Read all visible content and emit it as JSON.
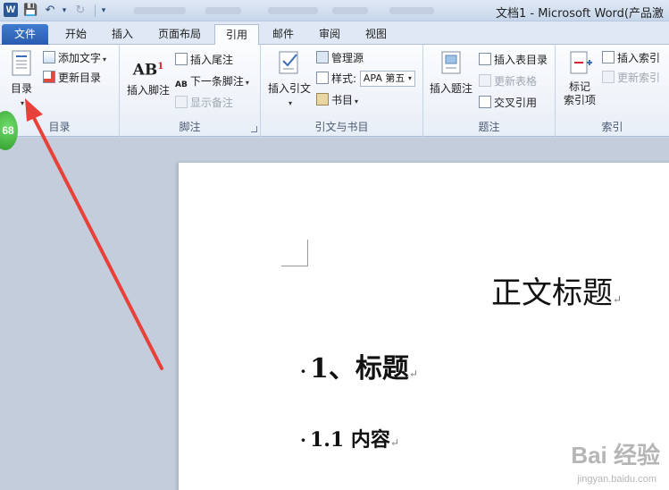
{
  "titlebar": {
    "title": "文档1 - Microsoft Word(产品激",
    "word_logo": "W"
  },
  "tabs": [
    {
      "label": "文件"
    },
    {
      "label": "开始"
    },
    {
      "label": "插入"
    },
    {
      "label": "页面布局"
    },
    {
      "label": "引用"
    },
    {
      "label": "邮件"
    },
    {
      "label": "审阅"
    },
    {
      "label": "视图"
    }
  ],
  "ribbon": {
    "toc_group": {
      "label": "目录",
      "toc_button": "目录",
      "add_text": "添加文字",
      "update_toc": "更新目录"
    },
    "footnote_group": {
      "label": "脚注",
      "insert_footnote": "插入脚注",
      "insert_endnote": "插入尾注",
      "next_footnote": "下一条脚注",
      "show_notes": "显示备注"
    },
    "citation_group": {
      "label": "引文与书目",
      "insert_citation": "插入引文",
      "manage_sources": "管理源",
      "style_label": "样式:",
      "style_value": "APA 第五",
      "bibliography": "书目"
    },
    "caption_group": {
      "label": "题注",
      "insert_caption": "插入题注",
      "insert_table_of_figures": "插入表目录",
      "update_table": "更新表格",
      "cross_reference": "交叉引用"
    },
    "index_group": {
      "label": "索引",
      "mark_entry": "标记\n索引项",
      "insert_index": "插入索引",
      "update_index": "更新索引"
    }
  },
  "document": {
    "title": "正文标题",
    "heading1": "1、标题",
    "heading2": "1.1 内容",
    "para_mark": "↵"
  },
  "badge": {
    "value": "68"
  },
  "watermark": {
    "text": "Bai 经验",
    "sub": "jingyan.baidu.com"
  },
  "colors": {
    "accent": "#2a5cb0",
    "arrow": "#e8413a",
    "badge": "#3aa836"
  }
}
